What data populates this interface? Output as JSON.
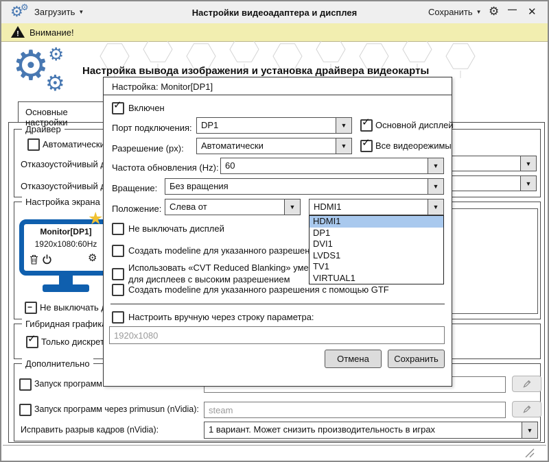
{
  "window": {
    "title": "Настройки видеоадаптера и дисплея",
    "load_button": "Загрузить",
    "save_button": "Сохранить"
  },
  "warning_bar": {
    "text": "Внимание!"
  },
  "header": {
    "title": "Настройка вывода изображения и установка драйвера видеокарты"
  },
  "tabs": {
    "main": "Основные настройки"
  },
  "driver_group": {
    "title": "Драйвер",
    "auto_label": "Автоматический в",
    "failsafe_label_1": "Отказоустойчивый др",
    "failsafe_label_2": "Отказоустойчивый др"
  },
  "screen_group": {
    "title": "Настройка экрана",
    "monitor_name": "Monitor[DP1]",
    "monitor_mode": "1920x1080:60Hz",
    "keep_on_label": "Не выключать ди"
  },
  "hybrid_group": {
    "title": "Гибридная графика",
    "discrete_label": "Только дискретно"
  },
  "extra_group": {
    "title": "Дополнительно",
    "run_label": "Запуск программ ч",
    "primusrun_label": "Запуск программ через primusun (nVidia):",
    "primusrun_placeholder": "steam",
    "tearing_label": "Исправить разрыв кадров (nVidia):",
    "tearing_value": "1 вариант. Может снизить производительность в играх"
  },
  "dialog": {
    "title": "Настройка: Monitor[DP1]",
    "enabled_label": "Включен",
    "port_label": "Порт подключения:",
    "port_value": "DP1",
    "primary_label": "Основной дисплей",
    "resolution_label": "Разрешение (px):",
    "resolution_value": "Автоматически",
    "all_modes_label": "Все видеорежимы",
    "refresh_label": "Частота обновления (Hz):",
    "refresh_value": "60",
    "rotation_label": "Вращение:",
    "rotation_value": "Без вращения",
    "position_label": "Положение:",
    "position_value": "Слева от",
    "position_target": "HDMI1",
    "options": [
      "HDMI1",
      "DP1",
      "DVI1",
      "LVDS1",
      "TV1",
      "VIRTUAL1"
    ],
    "keep_display_label": "Не выключать дисплей",
    "modeline_label": "Создать modeline для указанного разрешения",
    "cvt_label_line1": "Использовать «CVT Reduced Blanking» умен",
    "cvt_label_line2": "для дисплеев с высоким разрешением",
    "gtf_label": "Создать modeline для указанного разрешения с помощью GTF",
    "manual_label": "Настроить вручную через строку параметра:",
    "manual_placeholder": "1920x1080",
    "cancel_button": "Отмена",
    "save_button": "Сохранить"
  },
  "icons": {
    "dropdown_arrow": "▼",
    "check": "✓",
    "indeterminate": "−",
    "gear": "⚙",
    "star": "★",
    "minimize": "—",
    "close": "✕",
    "warning_mark": "!"
  },
  "colors": {
    "accent_blue": "#4878b2",
    "monitor_blue": "#0f5fae",
    "warning_bg": "#f2eeb0",
    "selection_blue": "#a9c9ee",
    "star_gold": "#f0c132"
  }
}
